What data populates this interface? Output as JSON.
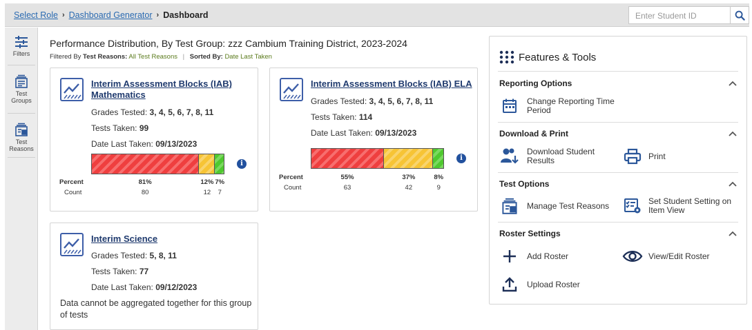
{
  "breadcrumb": {
    "items": [
      "Select Role",
      "Dashboard Generator"
    ],
    "current": "Dashboard"
  },
  "search": {
    "placeholder": "Enter Student ID"
  },
  "rail": {
    "filters": "Filters",
    "test_groups": "Test Groups",
    "test_reasons": "Test Reasons"
  },
  "header": {
    "title": "Performance Distribution, By Test Group: zzz Cambium Training District, 2023-2024",
    "filtered_by_label": "Filtered By",
    "test_reasons_label": "Test Reasons:",
    "test_reasons_value": "All Test Reasons",
    "sorted_by_label": "Sorted By:",
    "sorted_by_value": "Date Last Taken"
  },
  "cards": [
    {
      "title_line1": "Interim Assessment Blocks (IAB)",
      "title_line2": "Mathematics",
      "grades_label": "Grades Tested:",
      "grades": "3, 4, 5, 6, 7, 8, 11",
      "tests_label": "Tests Taken:",
      "tests": "99",
      "date_label": "Date Last Taken:",
      "date": "09/13/2023",
      "percent_label": "Percent",
      "count_label": "Count",
      "distribution": [
        {
          "percent": "81%",
          "count": "80",
          "share": 0.81,
          "color": "#ef3f3f"
        },
        {
          "percent": "12%",
          "count": "12",
          "share": 0.12,
          "color": "#f7c435"
        },
        {
          "percent": "7%",
          "count": "7",
          "share": 0.07,
          "color": "#4fc92f"
        }
      ]
    },
    {
      "title": "Interim Assessment Blocks (IAB) ELA",
      "grades_label": "Grades Tested:",
      "grades": "3, 4, 5, 6, 7, 8, 11",
      "tests_label": "Tests Taken:",
      "tests": "114",
      "date_label": "Date Last Taken:",
      "date": "09/13/2023",
      "percent_label": "Percent",
      "count_label": "Count",
      "distribution": [
        {
          "percent": "55%",
          "count": "63",
          "share": 0.55,
          "color": "#ef3f3f"
        },
        {
          "percent": "37%",
          "count": "42",
          "share": 0.37,
          "color": "#f7c435"
        },
        {
          "percent": "8%",
          "count": "9",
          "share": 0.08,
          "color": "#4fc92f"
        }
      ]
    },
    {
      "title": "Interim Science",
      "grades_label": "Grades Tested:",
      "grades": "5, 8, 11",
      "tests_label": "Tests Taken:",
      "tests": "77",
      "date_label": "Date Last Taken:",
      "date": "09/12/2023",
      "note": "Data cannot be aggregated together for this group of tests"
    }
  ],
  "features": {
    "title": "Features & Tools",
    "reporting": {
      "heading": "Reporting Options",
      "change_period": "Change Reporting Time Period"
    },
    "download": {
      "heading": "Download & Print",
      "download_results": "Download Student Results",
      "print": "Print"
    },
    "test_options": {
      "heading": "Test Options",
      "manage_reasons": "Manage Test Reasons",
      "student_setting": "Set Student Setting on Item View"
    },
    "roster": {
      "heading": "Roster Settings",
      "add": "Add Roster",
      "view_edit": "View/Edit Roster",
      "upload": "Upload Roster"
    }
  }
}
